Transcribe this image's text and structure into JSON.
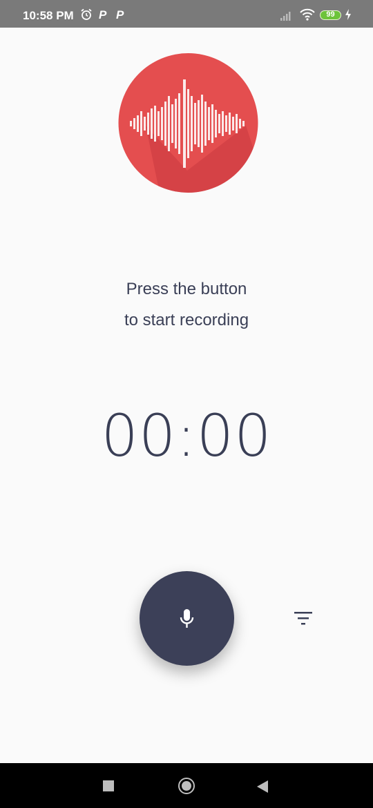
{
  "status_bar": {
    "time": "10:58 PM",
    "p1": "P",
    "p2": "P",
    "battery": "99",
    "icons": [
      "alarm-icon",
      "signal-icon",
      "wifi-icon",
      "battery-icon",
      "charging-icon"
    ]
  },
  "app": {
    "logo": "sound-wave-logo",
    "prompt_line1": "Press the button",
    "prompt_line2": "to start recording",
    "timer": "00:00",
    "record_button": "mic-icon",
    "filter_button": "filter-icon"
  },
  "nav_bar": {
    "icons": [
      "recents-square-icon",
      "home-circle-icon",
      "back-triangle-icon"
    ]
  },
  "colors": {
    "accent_red": "#e44e4f",
    "text_dark": "#3a3f56",
    "button_dark": "#3c4058",
    "battery_green": "#6dc33a"
  }
}
